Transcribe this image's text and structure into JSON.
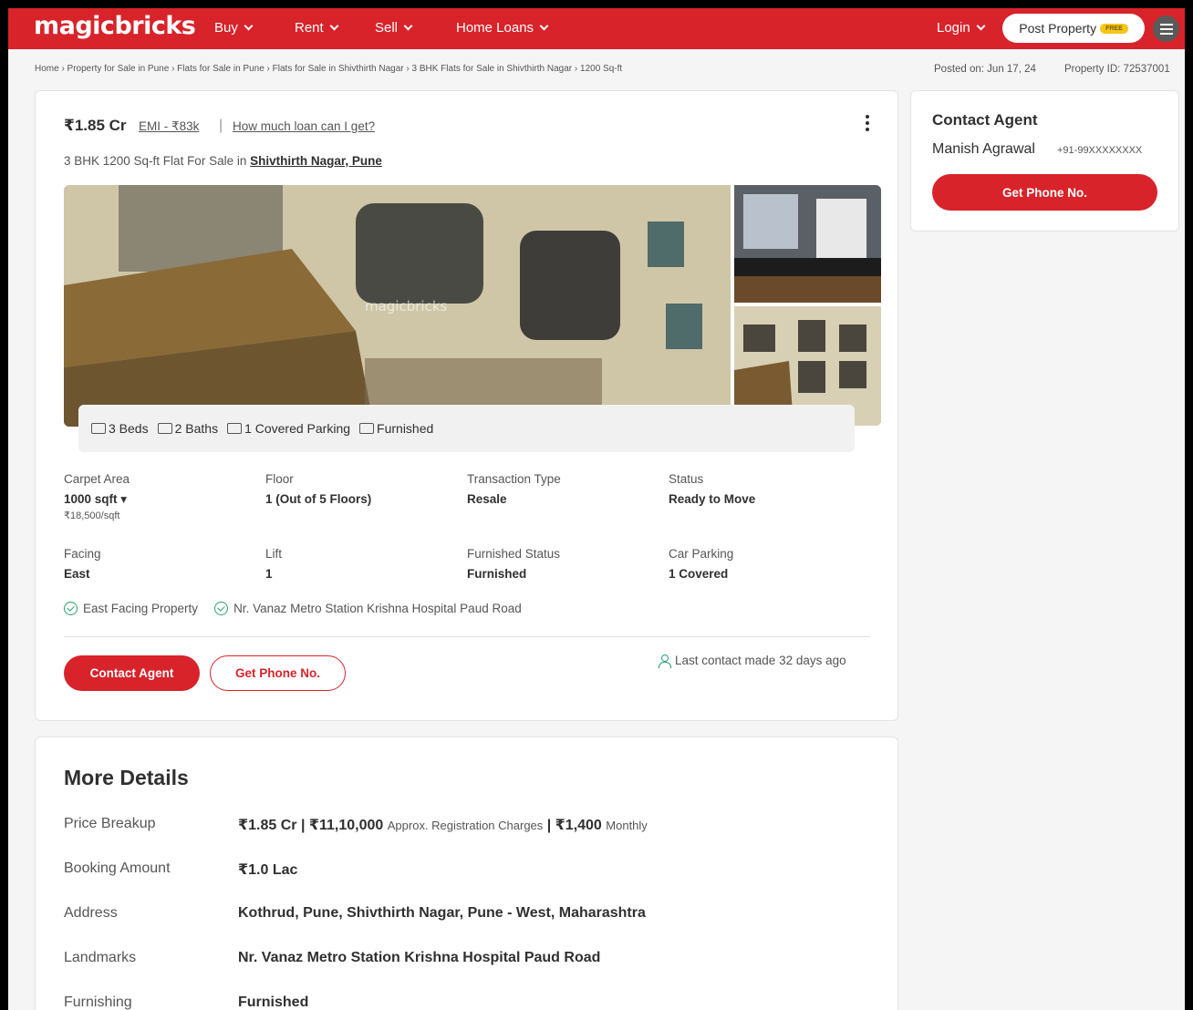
{
  "header": {
    "logo": "magicbricks",
    "nav": [
      "Buy",
      "Rent",
      "Sell",
      "Home Loans"
    ],
    "login": "Login",
    "post_property": "Post Property",
    "free_badge": "FREE",
    "brand_color": "#d8232a"
  },
  "breadcrumb": "Home › Property for Sale in Pune › Flats for Sale in Pune › Flats for Sale in Shivthirth Nagar › 3 BHK Flats for Sale in Shivthirth Nagar › 1200 Sq-ft",
  "posted_on": "Posted on: Jun 17, 24",
  "property_id": "Property ID: 72537001",
  "listing": {
    "price": "₹1.85 Cr",
    "emi": "EMI - ₹83k",
    "separator": "|",
    "loan_link": "How much loan can I get?",
    "subtitle_prefix": "3 BHK 1200 Sq-ft Flat For Sale in",
    "subtitle_location": "Shivthirth Nagar, Pune",
    "watermark": "magicbricks",
    "amenities": [
      "3 Beds",
      "2 Baths",
      "1 Covered Parking",
      "Furnished"
    ],
    "summary": [
      {
        "label": "Carpet Area",
        "value": "1000 sqft ▾",
        "sub": "₹18,500/sqft"
      },
      {
        "label": "Floor",
        "value": "1 (Out of 5 Floors)"
      },
      {
        "label": "Transaction Type",
        "value": "Resale"
      },
      {
        "label": "Status",
        "value": "Ready to Move"
      },
      {
        "label": "Facing",
        "value": "East"
      },
      {
        "label": "Lift",
        "value": "1"
      },
      {
        "label": "Furnished Status",
        "value": "Furnished"
      },
      {
        "label": "Car Parking",
        "value": "1 Covered"
      }
    ],
    "tags": [
      "East Facing Property",
      "Nr. Vanaz Metro Station Krishna Hospital Paud Road"
    ],
    "contact_agent_btn": "Contact Agent",
    "get_phone_btn": "Get Phone No.",
    "last_contact": "Last contact made 32 days ago"
  },
  "agent": {
    "title": "Contact Agent",
    "name": "Manish Agrawal",
    "phone": "+91-99XXXXXXXX",
    "get_phone_btn": "Get Phone No."
  },
  "more_details": {
    "title": "More Details",
    "rows": [
      {
        "label": "Price Breakup",
        "value": "₹1.85 Cr | ₹11,10,000",
        "note": "Approx. Registration Charges",
        "value2": "| ₹1,400",
        "note2": "Monthly"
      },
      {
        "label": "Booking Amount",
        "value": "₹1.0 Lac"
      },
      {
        "label": "Address",
        "value": "Kothrud, Pune, Shivthirth Nagar, Pune - West, Maharashtra"
      },
      {
        "label": "Landmarks",
        "value": "Nr. Vanaz Metro Station Krishna Hospital Paud Road"
      },
      {
        "label": "Furnishing",
        "value": "Furnished"
      }
    ]
  }
}
